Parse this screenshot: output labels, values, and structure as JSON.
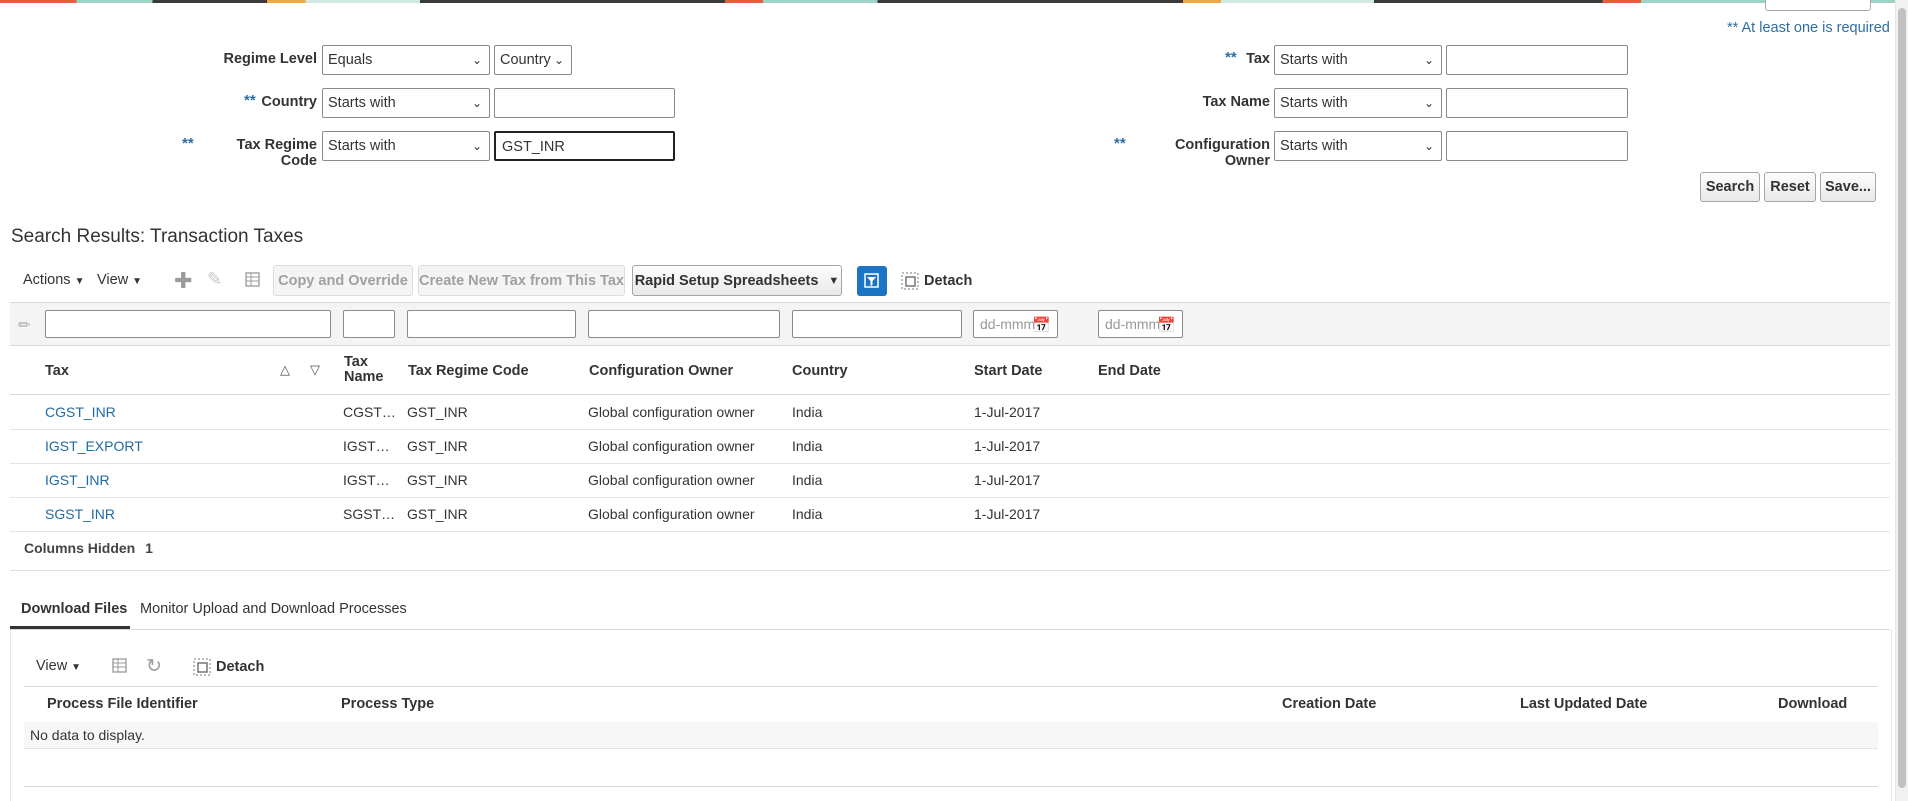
{
  "required_note": "** At least one is required",
  "required_marker": "**",
  "search_form": {
    "regime_level": {
      "label": "Regime Level",
      "operator": "Equals",
      "value": "Country"
    },
    "country": {
      "label": "Country",
      "operator": "Starts with",
      "value": ""
    },
    "tax_regime_code": {
      "label": "Tax Regime Code",
      "operator": "Starts with",
      "value": "GST_INR"
    },
    "tax": {
      "label": "Tax",
      "operator": "Starts with",
      "value": ""
    },
    "tax_name": {
      "label": "Tax Name",
      "operator": "Starts with",
      "value": ""
    },
    "configuration_owner": {
      "label": "Configuration Owner",
      "operator": "Starts with",
      "value": ""
    }
  },
  "buttons": {
    "search": "Search",
    "reset": "Reset",
    "save": "Save..."
  },
  "results": {
    "title": "Search Results: Transaction Taxes",
    "toolbar": {
      "actions": "Actions",
      "view": "View",
      "copy_override": "Copy and Override",
      "create_new": "Create New Tax from This Tax",
      "rapid_setup": "Rapid Setup Spreadsheets",
      "detach": "Detach"
    },
    "date_placeholder": "dd-mmm",
    "columns": [
      "Tax",
      "Tax Name",
      "Tax Regime Code",
      "Configuration Owner",
      "Country",
      "Start Date",
      "End Date"
    ],
    "rows": [
      {
        "tax": "CGST_INR",
        "tax_name": "CGST…",
        "regime": "GST_INR",
        "owner": "Global configuration owner",
        "country": "India",
        "start": "1-Jul-2017",
        "end": ""
      },
      {
        "tax": "IGST_EXPORT",
        "tax_name": "IGST…",
        "regime": "GST_INR",
        "owner": "Global configuration owner",
        "country": "India",
        "start": "1-Jul-2017",
        "end": ""
      },
      {
        "tax": "IGST_INR",
        "tax_name": "IGST…",
        "regime": "GST_INR",
        "owner": "Global configuration owner",
        "country": "India",
        "start": "1-Jul-2017",
        "end": ""
      },
      {
        "tax": "SGST_INR",
        "tax_name": "SGST…",
        "regime": "GST_INR",
        "owner": "Global configuration owner",
        "country": "India",
        "start": "1-Jul-2017",
        "end": ""
      }
    ],
    "columns_hidden_label": "Columns Hidden",
    "columns_hidden_count": "1"
  },
  "tabs": [
    "Download Files",
    "Monitor Upload and Download Processes"
  ],
  "downloads": {
    "view": "View",
    "detach": "Detach",
    "columns": [
      "Process File Identifier",
      "Process Type",
      "Creation Date",
      "Last Updated Date",
      "Download"
    ],
    "empty": "No data to display."
  },
  "icons": [
    "add-icon",
    "edit-icon",
    "freeze-icon",
    "query-by-example-icon",
    "detach-icon",
    "calendar-icon",
    "sort-ascending-icon",
    "sort-descending-icon",
    "refresh-icon",
    "chevron-down-icon"
  ],
  "colors": {
    "link": "#1f6aa5",
    "required": "#2e6ea3",
    "accent": "#1c74c4"
  }
}
